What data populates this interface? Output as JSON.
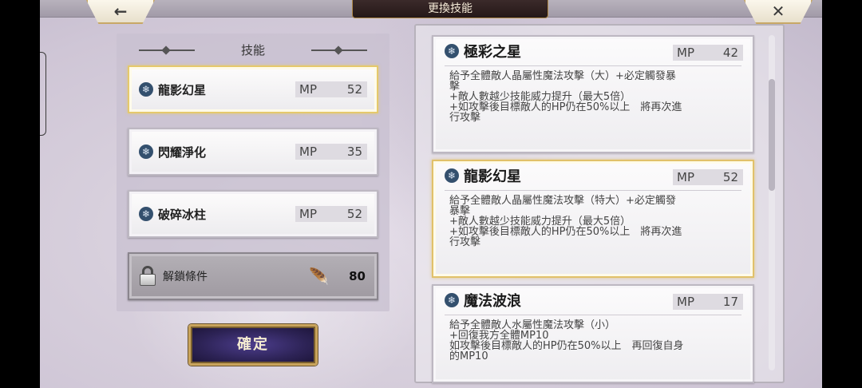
{
  "header": {
    "title": "更換技能",
    "back_icon": "←",
    "close_icon": "✕"
  },
  "left_panel": {
    "header": "技能",
    "slots": [
      {
        "name": "龍影幻星",
        "mp_label": "MP",
        "mp": "52",
        "selected": true
      },
      {
        "name": "閃耀淨化",
        "mp_label": "MP",
        "mp": "35",
        "selected": false
      },
      {
        "name": "破碎冰柱",
        "mp_label": "MP",
        "mp": "52",
        "selected": false
      }
    ],
    "locked_slot": {
      "label": "解鎖條件",
      "count": "80"
    },
    "confirm_label": "確定"
  },
  "skill_list": [
    {
      "name": "極彩之星",
      "mp_label": "MP",
      "mp": "42",
      "description": "給予全體敵人晶屬性魔法攻擊（大）+必定觸發暴\n擊\n+敵人數越少技能威力提升（最大5倍）\n+如攻擊後目標敵人的HP仍在50%以上　將再次進\n行攻擊",
      "selected": false
    },
    {
      "name": "龍影幻星",
      "mp_label": "MP",
      "mp": "52",
      "description": "給予全體敵人晶屬性魔法攻擊（特大）+必定觸發\n暴擊\n+敵人數越少技能威力提升（最大5倍）\n+如攻擊後目標敵人的HP仍在50%以上　將再次進\n行攻擊",
      "selected": true
    },
    {
      "name": "魔法波浪",
      "mp_label": "MP",
      "mp": "17",
      "description": "給予全體敵人水屬性魔法攻擊（小）\n+回復我方全體MP10\n如攻擊後目標敵人的HP仍在50%以上　再回復自身\n的MP10",
      "selected": false
    }
  ],
  "colors": {
    "gold_border": "#e1c16a",
    "confirm_button": "#2d2356",
    "title_plate": "#241818"
  },
  "icons": {
    "skill": "snowflake-icon",
    "lock": "lock-icon",
    "feather": "feather-icon"
  }
}
